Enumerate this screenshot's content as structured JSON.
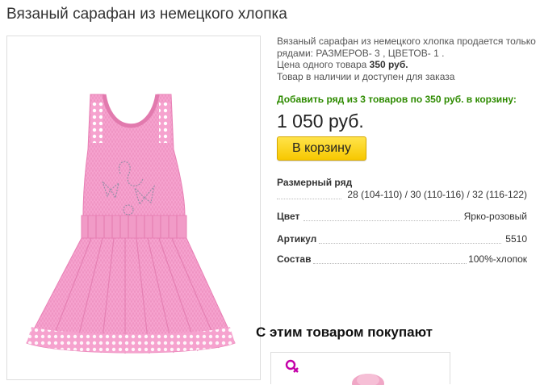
{
  "product": {
    "title": "Вязаный сарафан из немецкого хлопка",
    "description_line1": "Вязаный сарафан из немецкого хлопка продается только",
    "description_line2": "рядами: РАЗМЕРОВ- 3 , ЦВЕТОВ- 1 .",
    "price_label": "Цена одного товара ",
    "unit_price": "350 руб.",
    "availability": "Товар в наличии и доступен для заказа",
    "offer_text": "Добавить ряд из 3 товаров по 350 руб. в корзину:",
    "total_price": "1 050 руб.",
    "cart_button_label": "В корзину"
  },
  "specs": {
    "size_row_label": "Размерный ряд",
    "size_row_value": "28 (104-110) / 30 (110-116) / 32 (116-122)",
    "color_label": "Цвет",
    "color_value": "Ярко-розовый",
    "article_label": "Артикул",
    "article_value": "5510",
    "composition_label": "Состав",
    "composition_value": "100%-хлопок"
  },
  "related": {
    "title": "С этим товаром покупают"
  },
  "colors": {
    "offer_green": "#2e8b00",
    "button_yellow": "#f7c800",
    "dress_pink": "#f49ac8"
  },
  "icons": {
    "related_badge": "gender-female-icon"
  }
}
